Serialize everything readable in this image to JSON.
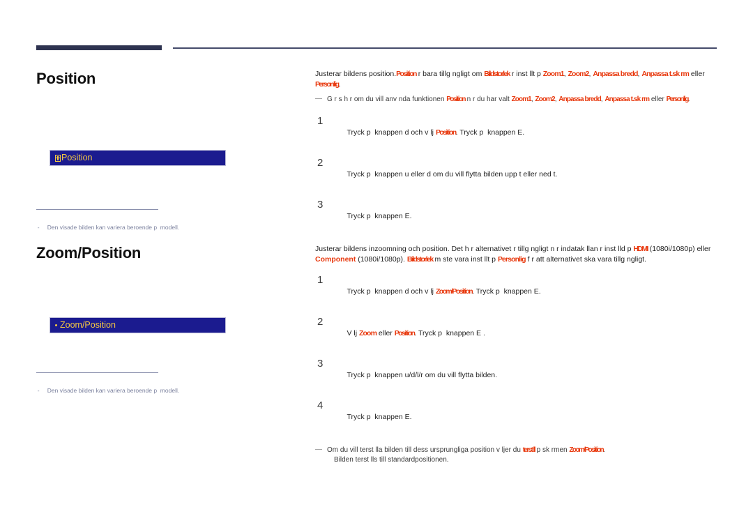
{
  "header": {
    "rule_thick_color": "#2e3350",
    "rule_thin_color": "#454b6b"
  },
  "sections": [
    {
      "id": "position",
      "title": "Position",
      "osd": {
        "icon": "tofu-missing-glyph-icon",
        "label": "Position",
        "background": "#1b1b8f",
        "text_color": "#f5c842"
      },
      "caption_note": "Den visade bilden kan variera beroende p  modell.",
      "intro": {
        "lead": "Justerar bildens position.",
        "term_1": "Position",
        "mid_1": " r bara tillg ngligt om ",
        "term_2": "Bildstorlek",
        "mid_2": " r inst llt p  ",
        "term_3": "Zoom1",
        "sep_1": ", ",
        "term_4": "Zoom2",
        "sep_2": ", ",
        "term_5": "Anpassa bredd",
        "sep_3": ", ",
        "term_6": "Anpassa t.sk rm",
        "mid_3": " eller ",
        "term_7": "Personlig",
        "tail": "."
      },
      "note": {
        "lead": "G r s  h r om du vill anv nda funktionen ",
        "term_1": "Position",
        "mid_1": " n r du har valt ",
        "term_2": "Zoom1",
        "sep_1": ", ",
        "term_3": "Zoom2",
        "sep_2": ", ",
        "term_4": "Anpassa bredd",
        "sep_3": ", ",
        "term_5": "Anpassa t.sk rm",
        "mid_2": " eller ",
        "term_6": "Personlig",
        "tail": "."
      },
      "steps": [
        {
          "num": "1",
          "pre": "Tryck p  knappen d och v lj ",
          "term": "Position",
          "post": ". Tryck p  knappen E."
        },
        {
          "num": "2",
          "pre": "Tryck p  knappen u eller d om du vill flytta bilden upp t eller ned t.",
          "term": "",
          "post": ""
        },
        {
          "num": "3",
          "pre": "Tryck p  knappen E.",
          "term": "",
          "post": ""
        }
      ]
    },
    {
      "id": "zoom-position",
      "title": "Zoom/Position",
      "osd": {
        "icon": "bullet-dot-icon",
        "label": "Zoom/Position",
        "background": "#1b1b8f",
        "text_color": "#f5c842"
      },
      "caption_note": "Den visade bilden kan variera beroende p  modell.",
      "intro": {
        "lead": "Justerar bildens inzoomning och position. Det h r alternativet  r tillg ngligt n r indatak llan  r inst lld p  ",
        "term_1": "HDMI",
        "mid_1": " (1080i/1080p) eller ",
        "term_2": "Component",
        "mid_2": " (1080i/1080p). ",
        "term_3": "Bildstorlek",
        "mid_3": " m ste vara inst llt p  ",
        "term_4": "Personlig",
        "tail": " f r att alternativet ska vara tillg ngligt."
      },
      "note": {
        "lead": "Om du vill  terst lla bilden till dess ursprungliga position v ljer du ",
        "term_1": "terst ll",
        "mid_1": " p  sk rmen ",
        "term_2": "Zoom/Position",
        "tail": ".",
        "second_line": "Bilden  terst lls till standardpositionen."
      },
      "steps": [
        {
          "num": "1",
          "pre": "Tryck p  knappen d och v lj ",
          "term": "Zoom/Position",
          "post": ". Tryck p  knappen E."
        },
        {
          "num": "2",
          "pre": "V lj ",
          "term": "Zoom",
          "mid": " eller ",
          "term2": "Position",
          "post": ". Tryck p  knappen E ."
        },
        {
          "num": "3",
          "pre": "Tryck p  knappen u/d/l/r om du vill flytta bilden.",
          "term": "",
          "post": ""
        },
        {
          "num": "4",
          "pre": "Tryck p  knappen E.",
          "term": "",
          "post": ""
        }
      ]
    }
  ],
  "colors": {
    "highlight": "#e8380d",
    "osd_blue": "#1b1b8f",
    "osd_yellow": "#f5c842",
    "note_gray": "#7b819e"
  }
}
